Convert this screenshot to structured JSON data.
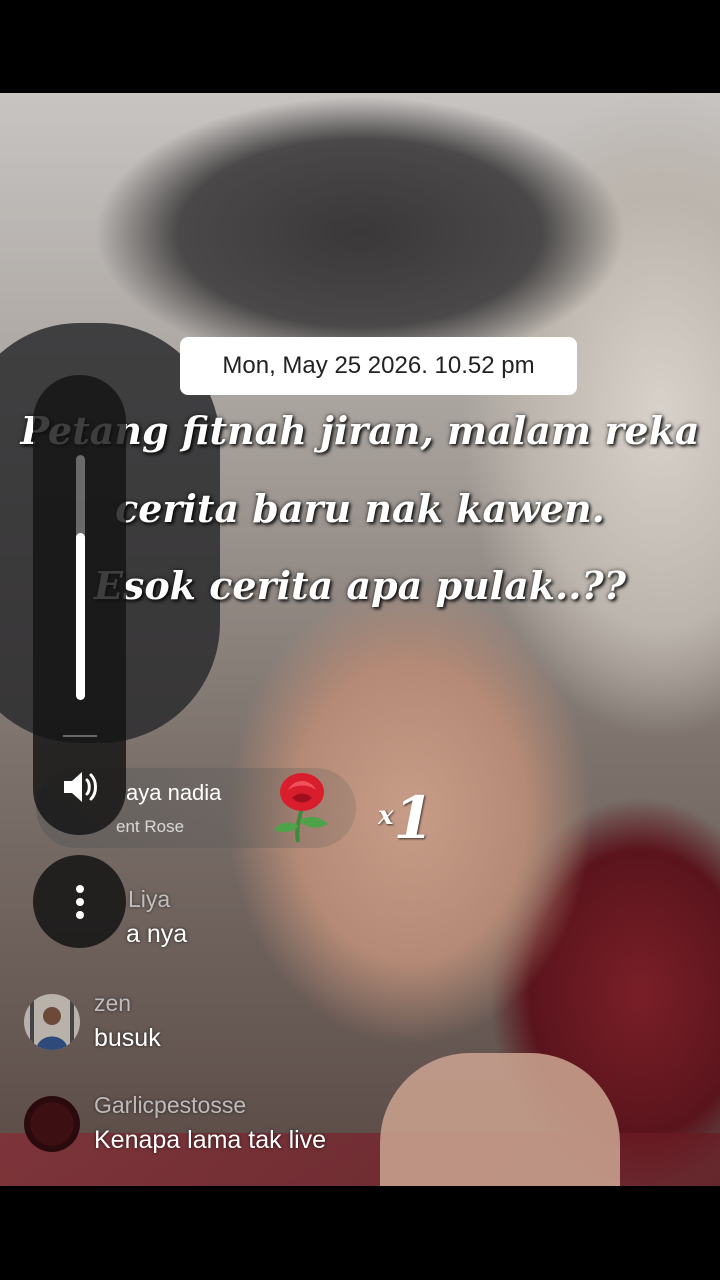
{
  "overlay": {
    "datetime": "Mon, May 25 2026. 10.52 pm",
    "caption_lines": [
      "Petang fitnah jiran, malam reka",
      "cerita baru nak kawen.",
      "Esok cerita apa pulak..??"
    ]
  },
  "volume": {
    "icon": "speaker-icon",
    "level": 0.68
  },
  "more_button": {
    "icon": "more-vertical-icon"
  },
  "gift": {
    "user": "aya nadia",
    "action": "ent Rose",
    "count_prefix": "x",
    "count": "1",
    "icon": "rose-icon"
  },
  "comments": [
    {
      "user": "Liya",
      "text": "a nya"
    },
    {
      "user": "zen",
      "text": "busuk"
    },
    {
      "user": "Garlicpestosse",
      "text": "Kenapa lama tak live"
    }
  ],
  "colors": {
    "caption": "#ffffff",
    "pill_bg": "#ffffff",
    "panel_bg": "#141414"
  }
}
